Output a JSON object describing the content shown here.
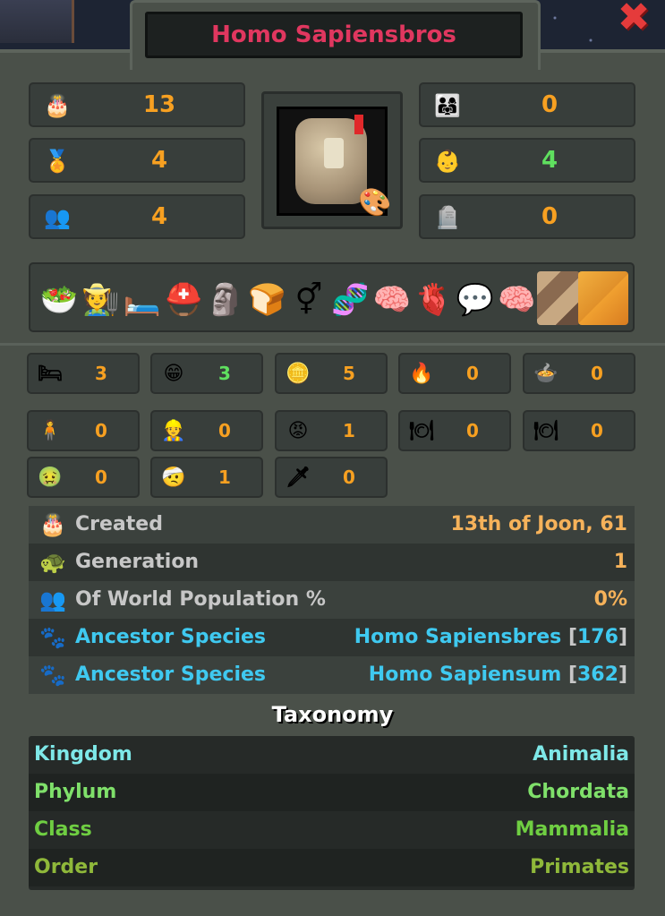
{
  "window": {
    "title": "Homo Sapiensbros",
    "close_symbol": "✖"
  },
  "colors": {
    "title": "#e0375f",
    "orange": "#f7a021",
    "green": "#5fe05f",
    "cyan": "#3fc9f0",
    "label_grey": "#c7c7c7",
    "value_peach": "#f6b25a"
  },
  "top_stats_left": [
    {
      "icon": "cake-icon",
      "glyph": "🎂",
      "value": "13",
      "color": "#f7a021"
    },
    {
      "icon": "laurel-icon",
      "glyph": "🏅",
      "value": "4",
      "color": "#f7a021"
    },
    {
      "icon": "population-icon",
      "glyph": "👥",
      "value": "4",
      "color": "#f7a021"
    }
  ],
  "top_stats_right": [
    {
      "icon": "family-icon",
      "glyph": "👨‍👩‍👧",
      "value": "0",
      "color": "#f7a021"
    },
    {
      "icon": "baby-icon",
      "glyph": "👶",
      "value": "4",
      "color": "#5fe05f"
    },
    {
      "icon": "gravestone-icon",
      "glyph": "🪦",
      "value": "0",
      "color": "#f7a021"
    }
  ],
  "traits": [
    {
      "icon": "food-plate-icon",
      "glyph": "🥗"
    },
    {
      "icon": "sleepy-farmer-icon",
      "glyph": "🧑‍🌾"
    },
    {
      "icon": "night-bed-icon",
      "glyph": "🛏️"
    },
    {
      "icon": "helmet-brain-icon",
      "glyph": "⛑️"
    },
    {
      "icon": "moai-icon",
      "glyph": "🗿"
    },
    {
      "icon": "bread-icon",
      "glyph": "🍞"
    },
    {
      "icon": "gender-icon",
      "glyph": "⚥"
    },
    {
      "icon": "dna-icon",
      "glyph": "🧬"
    },
    {
      "icon": "brain-bones-icon",
      "glyph": "🧠"
    },
    {
      "icon": "stomach-icon",
      "glyph": "🫀"
    },
    {
      "icon": "talking-brain-icon",
      "glyph": "💬"
    },
    {
      "icon": "brain-icon",
      "glyph": "🧠"
    }
  ],
  "trait_swatches": [
    "skin-tone-swatch",
    "fur-color-swatch"
  ],
  "counters_row1": [
    {
      "icon": "bed-icon",
      "glyph": "🛏",
      "value": "3",
      "color": "#f7a021"
    },
    {
      "icon": "happy-face-icon",
      "glyph": "😁",
      "value": "3",
      "color": "#5fe05f"
    },
    {
      "icon": "gold-coin-icon",
      "glyph": "🪙",
      "value": "5",
      "color": "#f7a021"
    },
    {
      "icon": "fire-face-icon",
      "glyph": "🔥",
      "value": "0",
      "color": "#f7a021"
    },
    {
      "icon": "pot-icon",
      "glyph": "🍲",
      "value": "0",
      "color": "#f7a021"
    }
  ],
  "counters_row2": [
    {
      "icon": "person-icon",
      "glyph": "🧍",
      "value": "0",
      "color": "#f7a021"
    },
    {
      "icon": "worker-icon",
      "glyph": "👷",
      "value": "0",
      "color": "#f7a021"
    },
    {
      "icon": "angry-face-icon",
      "glyph": "😡",
      "value": "1",
      "color": "#f7a021"
    },
    {
      "icon": "empty-plate-icon",
      "glyph": "🍽",
      "value": "0",
      "color": "#f7a021"
    },
    {
      "icon": "broken-plate-icon",
      "glyph": "🍽",
      "value": "0",
      "color": "#f7a021"
    }
  ],
  "counters_row3": [
    {
      "icon": "sick-head-icon",
      "glyph": "🤢",
      "value": "0",
      "color": "#f7a021"
    },
    {
      "icon": "injured-icon",
      "glyph": "🤕",
      "value": "1",
      "color": "#f7a021"
    },
    {
      "icon": "dagger-icon",
      "glyph": "🗡",
      "value": "0",
      "color": "#f7a021"
    }
  ],
  "info": {
    "created": {
      "label": "Created",
      "value": "13th of Joon, 61",
      "icon_glyph": "🎂"
    },
    "generation": {
      "label": "Generation",
      "value": "1",
      "icon_glyph": "🐢"
    },
    "population": {
      "label": "Of World Population %",
      "value": "0%",
      "icon_glyph": "👥"
    },
    "ancestors": [
      {
        "label": "Ancestor Species",
        "name": "Homo Sapiensbres",
        "bracket_open": "[",
        "id": "176",
        "bracket_close": "]",
        "icon_glyph": "🐾"
      },
      {
        "label": "Ancestor Species",
        "name": "Homo Sapiensum",
        "bracket_open": "[",
        "id": "362",
        "bracket_close": "]",
        "icon_glyph": "🐾"
      }
    ]
  },
  "taxonomy": {
    "title": "Taxonomy",
    "rows": [
      {
        "label": "Kingdom",
        "value": "Animalia",
        "color": "#7ee8e8"
      },
      {
        "label": "Phylum",
        "value": "Chordata",
        "color": "#7fe06a"
      },
      {
        "label": "Class",
        "value": "Mammalia",
        "color": "#6fce42"
      },
      {
        "label": "Order",
        "value": "Primates",
        "color": "#8fb83a"
      }
    ]
  }
}
